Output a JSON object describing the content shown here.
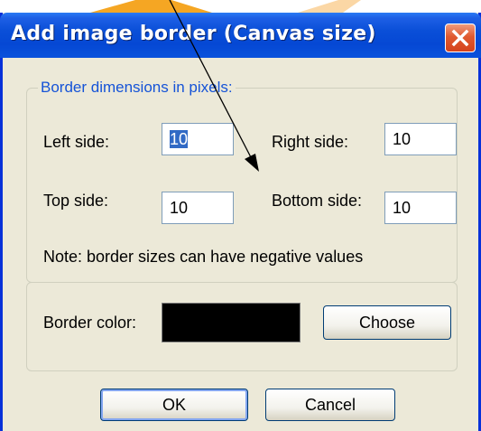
{
  "window": {
    "title": "Add image border (Canvas size)",
    "close_icon": "close-icon"
  },
  "dimensions_group": {
    "legend": "Border dimensions in pixels:",
    "left_label": "Left side:",
    "left_value": "10",
    "right_label": "Right side:",
    "right_value": "10",
    "top_label": "Top side:",
    "top_value": "10",
    "bottom_label": "Bottom side:",
    "bottom_value": "10",
    "note": "Note: border sizes can have negative values"
  },
  "color_group": {
    "label": "Border color:",
    "color": "#000000",
    "choose_label": "Choose"
  },
  "buttons": {
    "ok_label": "OK",
    "cancel_label": "Cancel"
  },
  "colors": {
    "titlebar": "#0a4fd8",
    "dialog_bg": "#ece9d8",
    "legend_text": "#1553d7",
    "annotation_arrow": "#000000",
    "background_arrow": "#f5a623"
  }
}
